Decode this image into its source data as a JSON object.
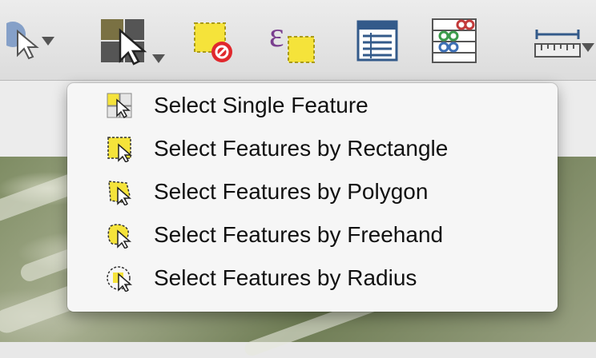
{
  "toolbar": {
    "buttons": [
      {
        "name": "identify-tool",
        "icon": "identify-cursor-icon",
        "has_dropdown": true
      },
      {
        "name": "select-features-tool",
        "icon": "select-features-icon",
        "has_dropdown": true
      },
      {
        "name": "deselect-all-tool",
        "icon": "deselect-features-icon",
        "has_dropdown": false
      },
      {
        "name": "select-by-expression-tool",
        "icon": "select-by-expression-icon",
        "has_dropdown": false
      },
      {
        "name": "attribute-table-tool",
        "icon": "attribute-table-icon",
        "has_dropdown": false
      },
      {
        "name": "field-calculator-tool",
        "icon": "field-calculator-icon",
        "has_dropdown": false
      },
      {
        "name": "measure-tool",
        "icon": "ruler-icon",
        "has_dropdown": true
      }
    ]
  },
  "menu": {
    "items": [
      {
        "label": "Select Single Feature",
        "icon": "select-single-feature-icon"
      },
      {
        "label": "Select Features by Rectangle",
        "icon": "select-by-rectangle-icon"
      },
      {
        "label": "Select Features by Polygon",
        "icon": "select-by-polygon-icon"
      },
      {
        "label": "Select Features by Freehand",
        "icon": "select-by-freehand-icon"
      },
      {
        "label": "Select Features by Radius",
        "icon": "select-by-radius-icon"
      }
    ]
  },
  "colors": {
    "selection_yellow": "#f5e33a",
    "deselect_red": "#e0282d",
    "expression_purple": "#7a3f8f",
    "toolbar_bg": "#e4e4e4",
    "menu_bg": "#f6f6f6"
  }
}
